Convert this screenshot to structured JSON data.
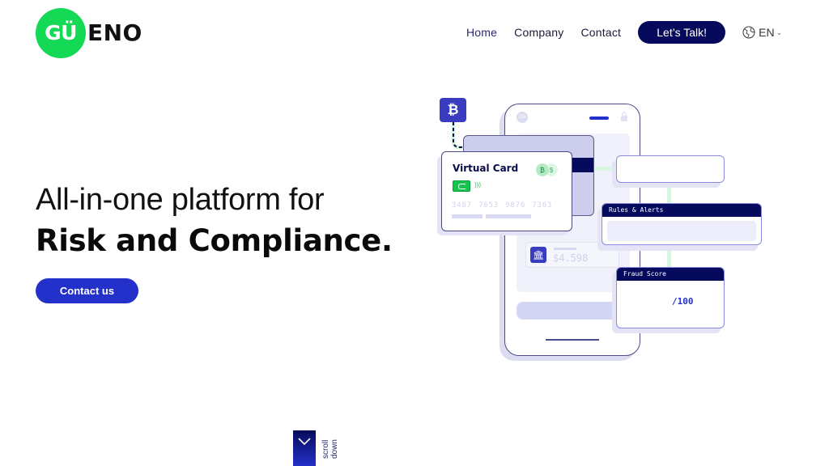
{
  "header": {
    "logo_mark": "GÜ",
    "logo_text": "ENO",
    "nav": [
      {
        "label": "Home",
        "active": true
      },
      {
        "label": "Company",
        "active": false
      },
      {
        "label": "Contact",
        "active": false
      }
    ],
    "cta_label": "Let’s Talk!",
    "language": "EN",
    "icons": {
      "language": "globe-icon",
      "dropdown": "chevron-down-icon"
    }
  },
  "hero": {
    "line1": "All-in-one platform for",
    "line2": "Risk and Compliance.",
    "contact_label": "Contact us"
  },
  "scroll": {
    "label": "scroll down",
    "icon": "chevron-down-icon"
  },
  "illustration": {
    "phone_avatar": "Gü",
    "virtual_card": {
      "title": "Virtual Card",
      "currency_badges": [
        "₿",
        "$"
      ],
      "number": "3487 7653 9876 7363"
    },
    "bitcoin_badge": "₿",
    "balance": "$4.598",
    "rules_panel_title": "Rules & Alerts",
    "fraud_panel_title": "Fraud Score",
    "fraud_score_suffix": "/100"
  },
  "colors": {
    "brand_green": "#13d954",
    "navy": "#050a5c",
    "primary_blue": "#2330c9",
    "lavender": "#d5d6f3"
  }
}
